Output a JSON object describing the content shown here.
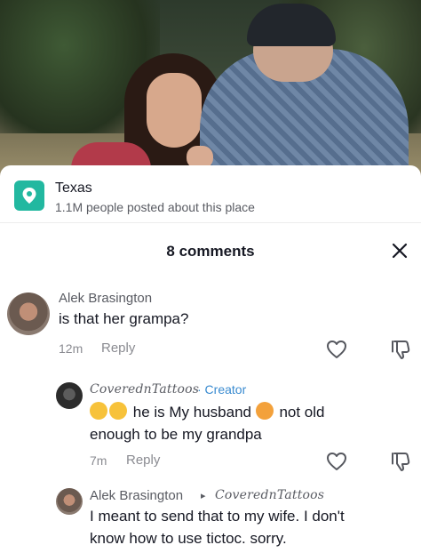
{
  "location": {
    "name": "Texas",
    "stats": "1.1M people posted about this place"
  },
  "comments_header": {
    "title": "8 comments"
  },
  "comments": [
    {
      "author": "Alek Brasington",
      "text": "is that her grampa?",
      "time": "12m",
      "reply_label": "Reply"
    },
    {
      "author": "CoverednTattoos",
      "creator_tag": "· Creator",
      "text_line1": "he is My husband",
      "text_line1b": "not old",
      "text_line2": "enough to be my grandpa",
      "time": "7m",
      "reply_label": "Reply"
    },
    {
      "author": "Alek Brasington",
      "reply_to_arrow": "▸",
      "reply_to": "CoverednTattoos",
      "text_line1": "I meant to send that to my wife. I don't",
      "text_line2": "know how to use tictoc. sorry."
    }
  ],
  "icons": {
    "location": "location-pin-icon",
    "close": "close-icon",
    "like": "heart-icon",
    "dislike": "dislike-icon",
    "emoji_laugh": "laughing-tears-emoji",
    "emoji_love": "smiling-hearts-emoji"
  },
  "colors": {
    "location_accent": "#22b8a0",
    "creator_blue": "#3a8bd0"
  }
}
